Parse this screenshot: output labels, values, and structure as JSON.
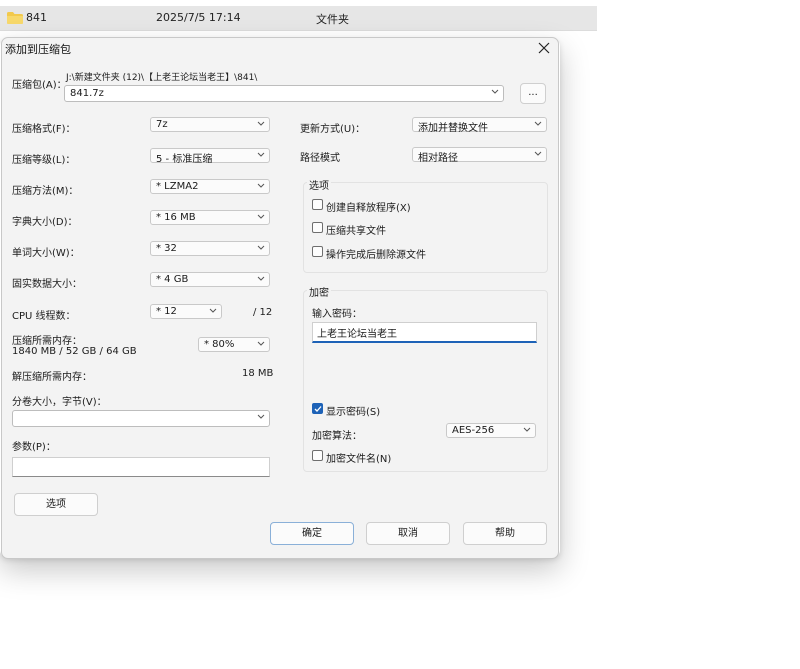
{
  "explorer": {
    "name": "841",
    "date": "2025/7/5 17:14",
    "type": "文件夹"
  },
  "dialog": {
    "title": "添加到压缩包",
    "archive_label": "压缩包(A)：",
    "archive_path": "J:\\新建文件夹 (12)\\【上老王论坛当老王】\\841\\",
    "archive_name": "841.7z",
    "browse_label": "...",
    "format_label": "压缩格式(F)：",
    "format_value": "7z",
    "level_label": "压缩等级(L)：",
    "level_value": "5 - 标准压缩",
    "method_label": "压缩方法(M)：",
    "method_value": "*  LZMA2",
    "dict_label": "字典大小(D)：",
    "dict_value": "*  16 MB",
    "word_label": "单词大小(W)：",
    "word_value": "*  32",
    "solid_label": "固实数据大小：",
    "solid_value": "*  4 GB",
    "threads_label": "CPU 线程数：",
    "threads_value": "*  12",
    "threads_max": "/ 12",
    "mem_label": "压缩所需内存：",
    "mem_detail": "1840 MB / 52 GB / 64 GB",
    "mem_value": "*  80%",
    "decomp_label": "解压缩所需内存：",
    "decomp_value": "18 MB",
    "split_label": "分卷大小，字节(V)：",
    "split_value": "",
    "params_label": "参数(P)：",
    "params_value": "",
    "options_button": "选项",
    "update_label": "更新方式(U)：",
    "update_value": "添加并替换文件",
    "path_label": "路径模式",
    "path_value": "相对路径",
    "options_group": "选项",
    "opt_sfx": "创建自释放程序(X)",
    "opt_shared": "压缩共享文件",
    "opt_delete": "操作完成后删除源文件",
    "encrypt_group": "加密",
    "password_label": "输入密码：",
    "password_value": "上老王论坛当老王",
    "show_password": "显示密码(S)",
    "enc_method_label": "加密算法：",
    "enc_method_value": "AES-256",
    "enc_names": "加密文件名(N)",
    "ok": "确定",
    "cancel": "取消",
    "help": "帮助"
  }
}
